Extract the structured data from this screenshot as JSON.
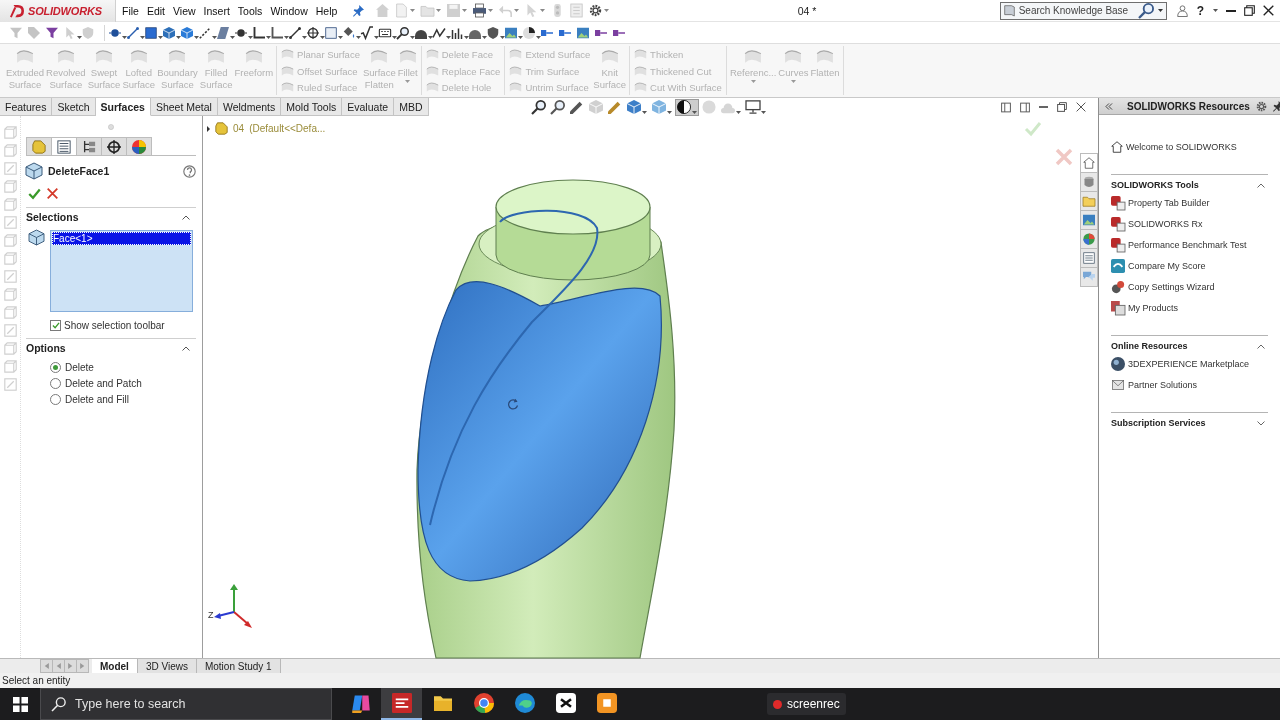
{
  "title_bar": {
    "logo": "SOLIDWORKS",
    "menu": [
      "File",
      "Edit",
      "View",
      "Insert",
      "Tools",
      "Window",
      "Help"
    ],
    "document_title": "04 *",
    "search": {
      "placeholder": "Search Knowledge Base"
    },
    "help": "?"
  },
  "ribbon": {
    "groups": [
      {
        "controls": [
          {
            "kind": "large",
            "label": "Extruded Surface",
            "disabled": true,
            "dropdown": false
          },
          {
            "kind": "large",
            "label": "Revolved Surface",
            "disabled": true,
            "dropdown": false
          },
          {
            "kind": "large",
            "label": "Swept Surface",
            "disabled": true,
            "dropdown": false
          },
          {
            "kind": "large",
            "label": "Lofted Surface",
            "disabled": true,
            "dropdown": false
          },
          {
            "kind": "large",
            "label": "Boundary Surface",
            "disabled": true,
            "dropdown": false
          },
          {
            "kind": "large",
            "label": "Filled Surface",
            "disabled": true,
            "dropdown": false
          },
          {
            "kind": "large",
            "label": "Freeform",
            "disabled": true,
            "dropdown": false
          }
        ]
      },
      {
        "controls": [
          {
            "kind": "stack",
            "items": [
              {
                "label": "Planar Surface",
                "disabled": true
              },
              {
                "label": "Offset Surface",
                "disabled": true
              },
              {
                "label": "Ruled Surface",
                "disabled": true
              }
            ]
          },
          {
            "kind": "large",
            "label": "Surface Flatten",
            "disabled": true,
            "dropdown": false
          },
          {
            "kind": "large",
            "label": "Fillet",
            "disabled": true,
            "dropdown": true
          }
        ]
      },
      {
        "controls": [
          {
            "kind": "stack",
            "items": [
              {
                "label": "Delete Face",
                "disabled": true
              },
              {
                "label": "Replace Face",
                "disabled": true
              },
              {
                "label": "Delete Hole",
                "disabled": true
              }
            ]
          }
        ]
      },
      {
        "controls": [
          {
            "kind": "stack",
            "items": [
              {
                "label": "Extend Surface",
                "disabled": true
              },
              {
                "label": "Trim Surface",
                "disabled": true
              },
              {
                "label": "Untrim Surface",
                "disabled": true
              }
            ]
          },
          {
            "kind": "large",
            "label": "Knit Surface",
            "disabled": true,
            "dropdown": false
          }
        ]
      },
      {
        "controls": [
          {
            "kind": "stack",
            "items": [
              {
                "label": "Thicken",
                "disabled": true
              },
              {
                "label": "Thickened Cut",
                "disabled": true
              },
              {
                "label": "Cut With Surface",
                "disabled": true
              }
            ]
          }
        ]
      },
      {
        "controls": [
          {
            "kind": "large",
            "label": "Referenc...",
            "disabled": true,
            "dropdown": true
          },
          {
            "kind": "large",
            "label": "Curves",
            "disabled": true,
            "dropdown": true
          },
          {
            "kind": "large",
            "label": "Flatten",
            "disabled": true,
            "dropdown": false
          }
        ]
      }
    ]
  },
  "command_tabs": [
    {
      "label": "Features",
      "selected": false
    },
    {
      "label": "Sketch",
      "selected": false
    },
    {
      "label": "Surfaces",
      "selected": true
    },
    {
      "label": "Sheet Metal",
      "selected": false
    },
    {
      "label": "Weldments",
      "selected": false
    },
    {
      "label": "Mold Tools",
      "selected": false
    },
    {
      "label": "Evaluate",
      "selected": false
    },
    {
      "label": "MBD",
      "selected": false
    }
  ],
  "view_toolbar": [
    {
      "pressed": false
    },
    {
      "pressed": false
    },
    {
      "pressed": false
    },
    {
      "pressed": false
    },
    {
      "pressed": false
    },
    {
      "pressed": false
    },
    {
      "pressed": false
    },
    {
      "pressed": true
    },
    {
      "pressed": false
    },
    {
      "pressed": false
    },
    {
      "pressed": false
    }
  ],
  "property_manager": {
    "tabs": [
      {
        "selected": false
      },
      {
        "selected": true
      },
      {
        "selected": false
      },
      {
        "selected": false
      },
      {
        "selected": false
      }
    ],
    "title": "DeleteFace1",
    "sections": [
      {
        "kind": "selections",
        "title": "Selections",
        "expanded": true,
        "list": [
          {
            "label": "Face<1>",
            "selected": true
          }
        ],
        "checkbox": {
          "label": "Show selection toolbar",
          "checked": true
        }
      },
      {
        "kind": "options",
        "title": "Options",
        "expanded": true,
        "options": [
          {
            "label": "Delete",
            "selected": true
          },
          {
            "label": "Delete and Patch",
            "selected": false
          },
          {
            "label": "Delete and Fill",
            "selected": false
          }
        ]
      }
    ]
  },
  "feature_tree": {
    "name": "04",
    "configuration": "(Default<<Defa..."
  },
  "triad": {
    "label": "Z"
  },
  "task_pane": {
    "title": "SOLIDWORKS Resources",
    "tabs": [
      {
        "selected": true
      },
      {
        "selected": false
      },
      {
        "selected": false
      },
      {
        "selected": false
      },
      {
        "selected": false
      },
      {
        "selected": false
      },
      {
        "selected": false
      }
    ],
    "welcome": "Welcome to SOLIDWORKS",
    "sections": [
      {
        "title": "SOLIDWORKS Tools",
        "expanded": true,
        "items": [
          "Property Tab Builder",
          "SOLIDWORKS Rx",
          "Performance Benchmark Test",
          "Compare My Score",
          "Copy Settings Wizard",
          "My Products"
        ]
      },
      {
        "title": "Online Resources",
        "expanded": true,
        "items": [
          "3DEXPERIENCE Marketplace",
          "Partner Solutions"
        ]
      },
      {
        "title": "Subscription Services",
        "expanded": false
      }
    ]
  },
  "model_tabs": [
    {
      "label": "Model",
      "selected": true
    },
    {
      "label": "3D Views",
      "selected": false
    },
    {
      "label": "Motion Study 1",
      "selected": false
    }
  ],
  "status_bar": {
    "message": "Select an entity"
  },
  "taskbar": {
    "search": {
      "placeholder": "Type here to search"
    },
    "apps": [
      {
        "active": false
      },
      {
        "active": true
      },
      {
        "active": false
      },
      {
        "active": false
      },
      {
        "active": false
      },
      {
        "active": false
      },
      {
        "active": false
      }
    ],
    "recorder": "screenrec"
  }
}
